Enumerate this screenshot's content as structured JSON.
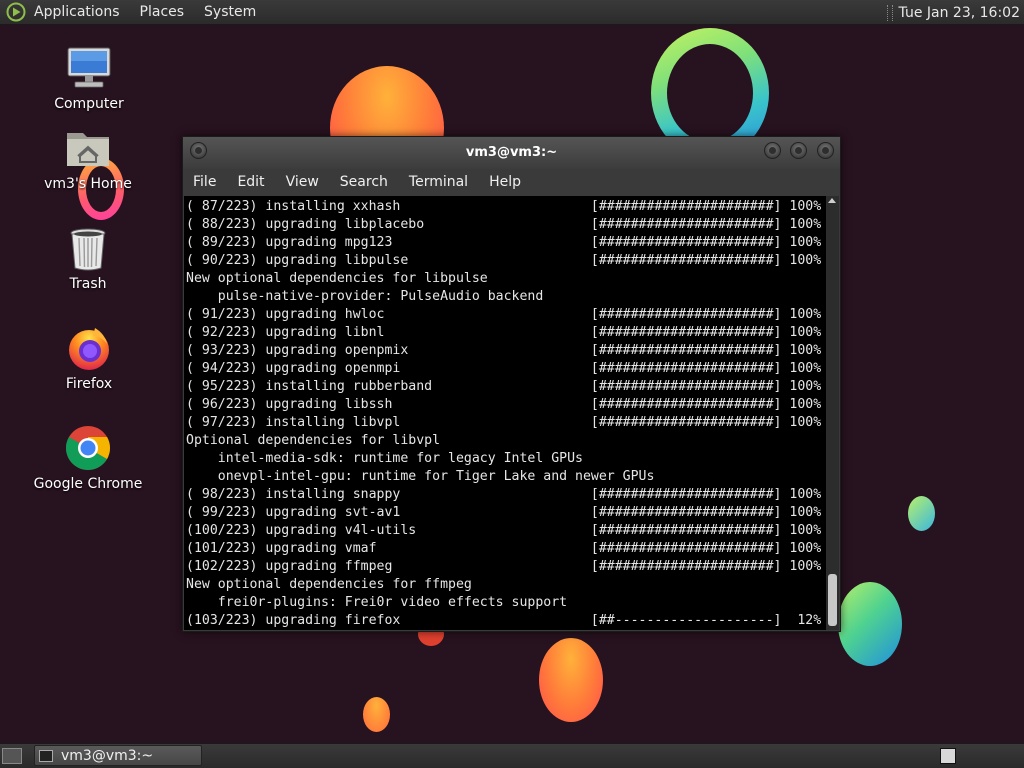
{
  "top_panel": {
    "menus": [
      "Applications",
      "Places",
      "System"
    ],
    "clock": "Tue Jan 23, 16:02"
  },
  "desktop": {
    "icons": [
      {
        "label": "Computer",
        "icon": "computer-icon"
      },
      {
        "label": "vm3's Home",
        "icon": "home-folder-icon"
      },
      {
        "label": "Trash",
        "icon": "trash-icon"
      },
      {
        "label": "Firefox",
        "icon": "firefox-icon"
      },
      {
        "label": "Google Chrome",
        "icon": "chrome-icon"
      }
    ]
  },
  "terminal": {
    "title": "vm3@vm3:~",
    "menu": [
      "File",
      "Edit",
      "View",
      "Search",
      "Terminal",
      "Help"
    ],
    "lines": [
      "( 87/223) installing xxhash                        [######################] 100%",
      "( 88/223) upgrading libplacebo                     [######################] 100%",
      "( 89/223) upgrading mpg123                         [######################] 100%",
      "( 90/223) upgrading libpulse                       [######################] 100%",
      "New optional dependencies for libpulse",
      "    pulse-native-provider: PulseAudio backend",
      "( 91/223) upgrading hwloc                          [######################] 100%",
      "( 92/223) upgrading libnl                          [######################] 100%",
      "( 93/223) upgrading openpmix                       [######################] 100%",
      "( 94/223) upgrading openmpi                        [######################] 100%",
      "( 95/223) installing rubberband                    [######################] 100%",
      "( 96/223) upgrading libssh                         [######################] 100%",
      "( 97/223) installing libvpl                        [######################] 100%",
      "Optional dependencies for libvpl",
      "    intel-media-sdk: runtime for legacy Intel GPUs",
      "    onevpl-intel-gpu: runtime for Tiger Lake and newer GPUs",
      "( 98/223) installing snappy                        [######################] 100%",
      "( 99/223) upgrading svt-av1                        [######################] 100%",
      "(100/223) upgrading v4l-utils                      [######################] 100%",
      "(101/223) upgrading vmaf                           [######################] 100%",
      "(102/223) upgrading ffmpeg                         [######################] 100%",
      "New optional dependencies for ffmpeg",
      "    frei0r-plugins: Frei0r video effects support",
      "(103/223) upgrading firefox                        [##--------------------]  12%"
    ]
  },
  "taskbar": {
    "window_button": "vm3@vm3:~"
  },
  "colors": {
    "desktop_bg": "#27121f",
    "panel_bg": "#2f2f2f",
    "terminal_bg": "#000000",
    "terminal_fg": "#e6e6e6"
  }
}
